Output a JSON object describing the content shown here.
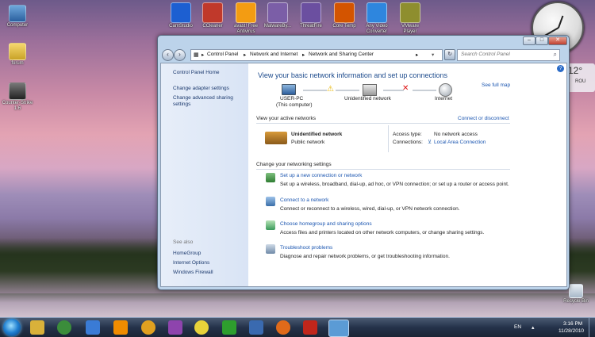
{
  "desktop": {
    "left_icons": [
      {
        "label": "Computer",
        "icon": "computer-icon"
      },
      {
        "label": "forum",
        "icon": "folder-icon"
      },
      {
        "label": "Counter-Strike 1.6",
        "icon": "counter-strike-icon"
      }
    ],
    "top_icons": [
      {
        "label": "CamStudio",
        "icon": "camstudio-icon",
        "color": "#1d5fd1"
      },
      {
        "label": "CCleaner",
        "icon": "ccleaner-icon",
        "color": "#c0392b"
      },
      {
        "label": "avast! Free Antivirus",
        "icon": "avast-icon",
        "color": "#f39c12"
      },
      {
        "label": "MalwareBy...",
        "icon": "malwarebytes-icon",
        "color": "#7b5ea7"
      },
      {
        "label": "ThreatFire",
        "icon": "threatfire-icon",
        "color": "#6b4fa0"
      },
      {
        "label": "Core Temp",
        "icon": "core-temp-icon",
        "color": "#d35400"
      },
      {
        "label": "Any Video Converter",
        "icon": "any-video-converter-icon",
        "color": "#2e86de"
      },
      {
        "label": "VMware Player",
        "icon": "vmware-icon",
        "color": "#8e8e2e"
      }
    ],
    "recycle_bin": "Recycle Bin",
    "weather": {
      "temp": "12°",
      "city": "ROU"
    }
  },
  "window": {
    "breadcrumb": [
      "Control Panel",
      "Network and Internet",
      "Network and Sharing Center"
    ],
    "search_placeholder": "Search Control Panel",
    "left_pane": {
      "home": "Control Panel Home",
      "links": [
        "Change adapter settings",
        "Change advanced sharing settings"
      ],
      "see_also_title": "See also",
      "see_also": [
        "HomeGroup",
        "Internet Options",
        "Windows Firewall"
      ]
    },
    "main": {
      "heading": "View your basic network information and set up connections",
      "see_full_map": "See full map",
      "nodes": {
        "pc_name": "USER-PC",
        "pc_sub": "(This computer)",
        "network": "Unidentified network",
        "internet": "Internet"
      },
      "active_title": "View your active networks",
      "connect_disconnect": "Connect or disconnect",
      "active_network": {
        "name": "Unidentified network",
        "type": "Public network"
      },
      "access_type_label": "Access type:",
      "access_type_value": "No network access",
      "connections_label": "Connections:",
      "connections_value": "Local Area Connection",
      "change_title": "Change your networking settings",
      "tasks": [
        {
          "title": "Set up a new connection or network",
          "desc": "Set up a wireless, broadband, dial-up, ad hoc, or VPN connection; or set up a router or access point."
        },
        {
          "title": "Connect to a network",
          "desc": "Connect or reconnect to a wireless, wired, dial-up, or VPN network connection."
        },
        {
          "title": "Choose homegroup and sharing options",
          "desc": "Access files and printers located on other network computers, or change sharing settings."
        },
        {
          "title": "Troubleshoot problems",
          "desc": "Diagnose and repair network problems, or get troubleshooting information."
        }
      ]
    }
  },
  "taskbar": {
    "lang": "EN",
    "time": "3:16 PM",
    "date": "11/28/2010",
    "apps": [
      {
        "icon": "explorer-icon",
        "color": "#d9b13a"
      },
      {
        "icon": "chrome-icon",
        "color": "#3b8d3b"
      },
      {
        "icon": "network-icon",
        "color": "#3a7bd5"
      },
      {
        "icon": "vlc-icon",
        "color": "#f08c00"
      },
      {
        "icon": "media-player-icon",
        "color": "#e0a020"
      },
      {
        "icon": "messenger-icon",
        "color": "#8e44ad"
      },
      {
        "icon": "disc-icon",
        "color": "#e8d23a"
      },
      {
        "icon": "utorrent-icon",
        "color": "#2e9e2e"
      },
      {
        "icon": "document-icon",
        "color": "#3a6ab0"
      },
      {
        "icon": "firefox-icon",
        "color": "#e06a1a"
      },
      {
        "icon": "pdf-icon",
        "color": "#c0261b"
      },
      {
        "icon": "control-panel-icon",
        "color": "#5b9bd5"
      }
    ]
  }
}
